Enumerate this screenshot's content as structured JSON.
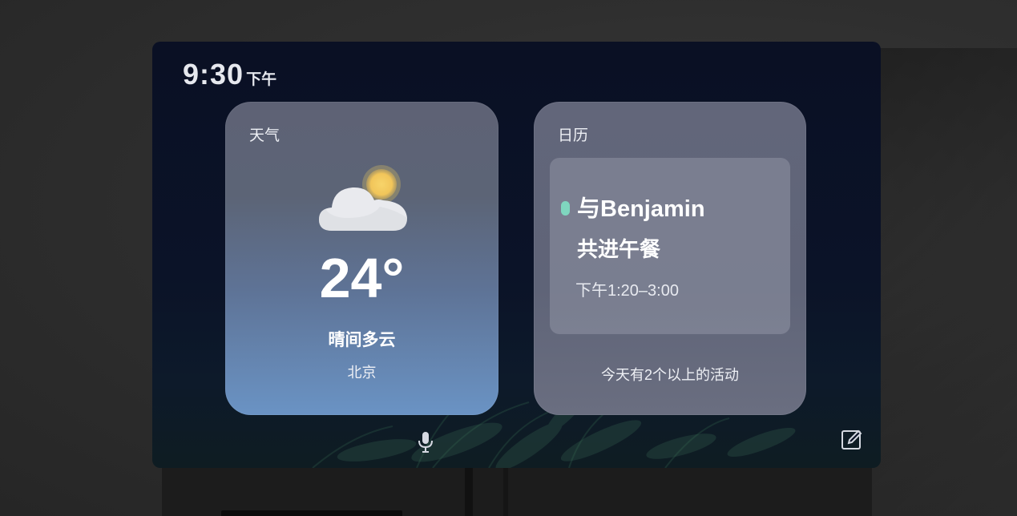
{
  "status": {
    "time": "9:30",
    "ampm": "下午"
  },
  "weather": {
    "title": "天气",
    "icon": "partly-cloudy-icon",
    "temperature": "24°",
    "condition": "晴间多云",
    "city": "北京"
  },
  "calendar": {
    "title": "日历",
    "event": {
      "title_line1": "与Benjamin",
      "title_line2": "共进午餐",
      "time": "下午1:20–3:00",
      "indicator_color": "#7fd6bf"
    },
    "more_events": "今天有2个以上的活动"
  },
  "toolbar": {
    "mic_icon": "microphone-icon",
    "edit_icon": "edit-icon"
  },
  "colors": {
    "screen_bg": "#0a1024",
    "weather_card_bottom": "#6a93c4",
    "calendar_card": "#62667a",
    "event_dot": "#7fd6bf"
  }
}
